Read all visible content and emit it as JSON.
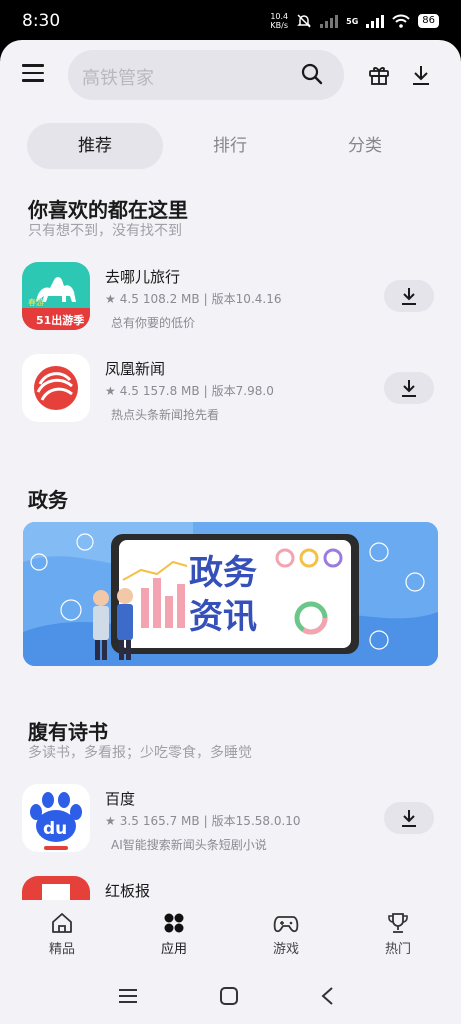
{
  "status_bar": {
    "time": "8:30",
    "net_speed_value": "10.4",
    "net_speed_unit": "KB/s",
    "network": "5G",
    "battery": "86"
  },
  "header": {
    "search_placeholder": "高铁管家"
  },
  "tabs": [
    {
      "label": "推荐",
      "active": true
    },
    {
      "label": "排行",
      "active": false
    },
    {
      "label": "分类",
      "active": false
    }
  ],
  "section_favorites": {
    "title": "你喜欢的都在这里",
    "subtitle": "只有想不到，没有找不到",
    "apps": [
      {
        "name": "去哪儿旅行",
        "rating": "4.5",
        "size": "108.2 MB",
        "version": "版本10.4.16",
        "desc": "总有你要的低价",
        "icon_text": "51出游季",
        "icon_text_top": "春游"
      },
      {
        "name": "凤凰新闻",
        "rating": "4.5",
        "size": "157.8 MB",
        "version": "版本7.98.0",
        "desc": "热点头条新闻抢先看"
      }
    ]
  },
  "section_gov": {
    "title": "政务",
    "banner_text_1": "政务",
    "banner_text_2": "资讯"
  },
  "section_books": {
    "title": "腹有诗书",
    "subtitle": "多读书，多看报；少吃零食，多睡觉",
    "apps": [
      {
        "name": "百度",
        "rating": "3.5",
        "size": "165.7 MB",
        "version": "版本15.58.0.10",
        "desc": "AI智能搜索新闻头条短剧小说",
        "icon_text": "du"
      },
      {
        "name": "红板报"
      }
    ]
  },
  "bottom_nav": [
    {
      "label": "精品"
    },
    {
      "label": "应用"
    },
    {
      "label": "游戏"
    },
    {
      "label": "热门"
    }
  ],
  "colors": {
    "background": "#f2f2f7",
    "qunar_green": "#2cc8b4",
    "ifeng_red": "#e5403a",
    "baidu_blue": "#2c5ee8",
    "banner_blue": "#6aaaf0"
  }
}
